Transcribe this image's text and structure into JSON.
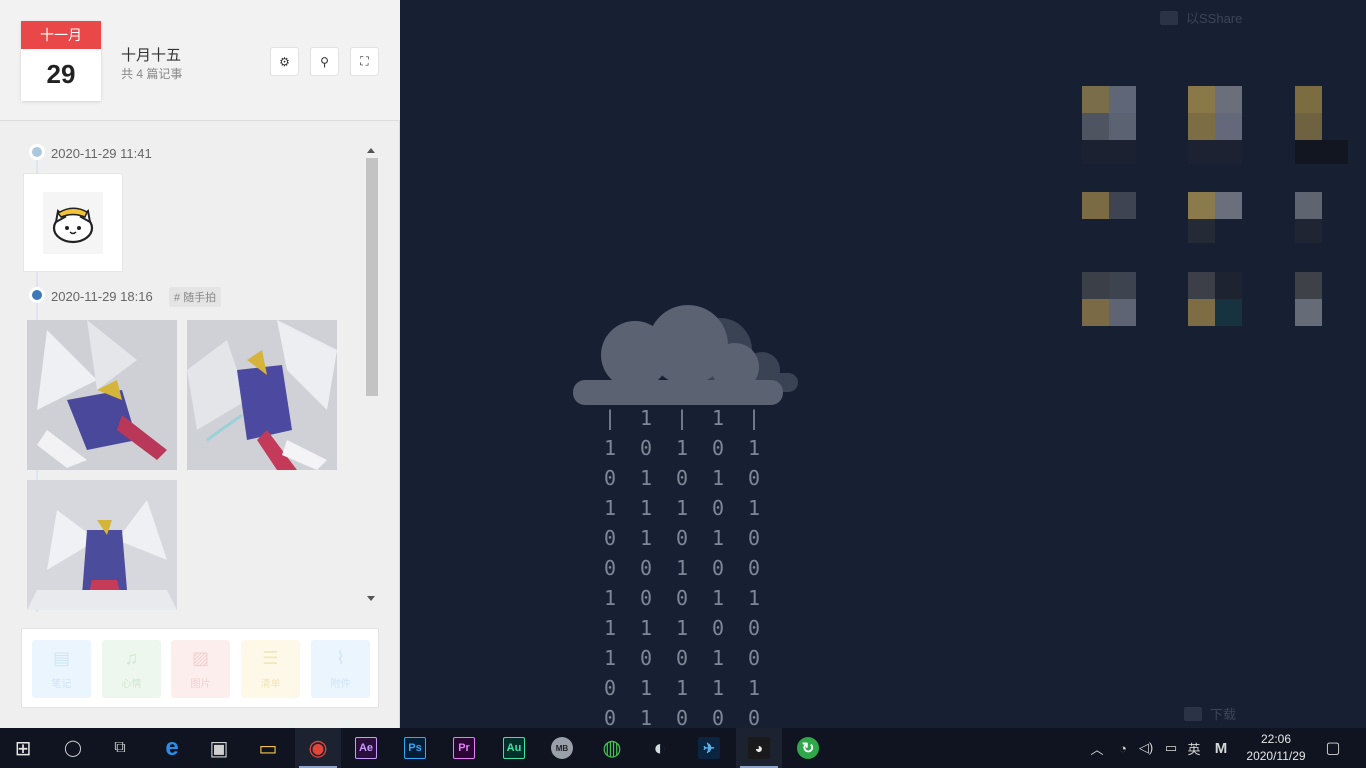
{
  "desktop": {
    "folder_top_label": "以SShare",
    "folder_bottom_label": "下载",
    "binary_columns": [
      "|\n1\n0\n1\n0\n0\n1\n1\n1\n0\n0\n1\n1",
      "1\n0\n1\n1\n1\n0\n0\n1\n0\n1\n1\n0",
      "|\n1\n0\n1\n0\n1\n0\n1\n0\n1\n0\n0",
      "1\n0\n1\n0\n1\n0\n1\n0\n1\n1\n0",
      "|\n1\n0\n1\n0\n0\n1\n0\n0\n1\n0"
    ]
  },
  "panel": {
    "calendar_month": "十一月",
    "calendar_day": "29",
    "lunar_date": "十月十五",
    "entry_count": "共 4 篇记事",
    "header_buttons": [
      {
        "icon": "gear-icon",
        "glyph": "⚙"
      },
      {
        "icon": "pin-icon",
        "glyph": "⚲"
      },
      {
        "icon": "fullscreen-icon",
        "glyph": "⛶"
      }
    ],
    "entries": [
      {
        "datetime": "2020-11-29 11:41",
        "dot_color": "#a9c8de"
      },
      {
        "datetime": "2020-11-29 18:16",
        "dot_color": "#3d79b6",
        "tag": "# 随手拍"
      }
    ],
    "toolbar": [
      {
        "label": "笔记",
        "icon": "note-icon",
        "glyph": "▤",
        "color": "#cfe5f8",
        "bg": "#eaf5fd"
      },
      {
        "label": "心情",
        "icon": "mood-icon",
        "glyph": "♫",
        "color": "#cfe7cf",
        "bg": "#edf7ed"
      },
      {
        "label": "图片",
        "icon": "image-icon",
        "glyph": "▨",
        "color": "#f3cfcf",
        "bg": "#fdeeee"
      },
      {
        "label": "清单",
        "icon": "list-icon",
        "glyph": "☰",
        "color": "#f3e6bd",
        "bg": "#fdf8e8"
      },
      {
        "label": "附件",
        "icon": "attachment-icon",
        "glyph": "⌇",
        "color": "#cfe5f8",
        "bg": "#eaf5fd"
      }
    ]
  },
  "taskbar": {
    "items": [
      {
        "name": "start-button",
        "glyph": "⊞",
        "color": "#e6e6e6",
        "bg": "transparent"
      },
      {
        "name": "cortana-icon",
        "glyph": "◯",
        "color": "#c8c8c8",
        "bg": "transparent"
      },
      {
        "name": "task-view-icon",
        "glyph": "⧉",
        "color": "#c8c8c8",
        "bg": "transparent"
      },
      {
        "name": "edge-icon",
        "glyph": "e",
        "color": "#2a8ee8",
        "bg": "transparent"
      },
      {
        "name": "store-icon",
        "glyph": "▣",
        "color": "#d0d0d0",
        "bg": "transparent"
      },
      {
        "name": "file-explorer-icon",
        "glyph": "▭",
        "color": "#f2c14e",
        "bg": "transparent"
      },
      {
        "name": "chrome-icon",
        "glyph": "◉",
        "color": "#e2463a",
        "bg": "transparent"
      },
      {
        "name": "after-effects-icon",
        "glyph": "Ae",
        "color": "#c79cf8",
        "bg": "#2a0f3d"
      },
      {
        "name": "photoshop-icon",
        "glyph": "Ps",
        "color": "#31a8ff",
        "bg": "#001e36"
      },
      {
        "name": "premiere-icon",
        "glyph": "Pr",
        "color": "#e77cf8",
        "bg": "#2a0634"
      },
      {
        "name": "audition-icon",
        "glyph": "Au",
        "color": "#3fe3a8",
        "bg": "#00302a"
      },
      {
        "name": "mini-app-icon",
        "glyph": "MB",
        "color": "#222",
        "bg": "#9aa0aa"
      },
      {
        "name": "wechat-icon",
        "glyph": "◍",
        "color": "#44c14f",
        "bg": "transparent"
      },
      {
        "name": "steam-icon",
        "glyph": "◐",
        "color": "#d5dbe3",
        "bg": "transparent"
      },
      {
        "name": "app-swirl-icon",
        "glyph": "✈",
        "color": "#5ab2e6",
        "bg": "#0b2540"
      },
      {
        "name": "cat-app-icon",
        "glyph": "◕",
        "color": "#eaeaea",
        "bg": "#1a1a1a"
      },
      {
        "name": "sync-app-icon",
        "glyph": "↻",
        "color": "#ffffff",
        "bg": "#2fa84a"
      }
    ],
    "tray_up_arrow": "︿",
    "tray_network": "◔",
    "tray_volume": "◁)",
    "tray_battery": "▭",
    "ime": "英",
    "ime_mode": "M",
    "time": "22:06",
    "date": "2020/11/29",
    "notification": "▢"
  }
}
